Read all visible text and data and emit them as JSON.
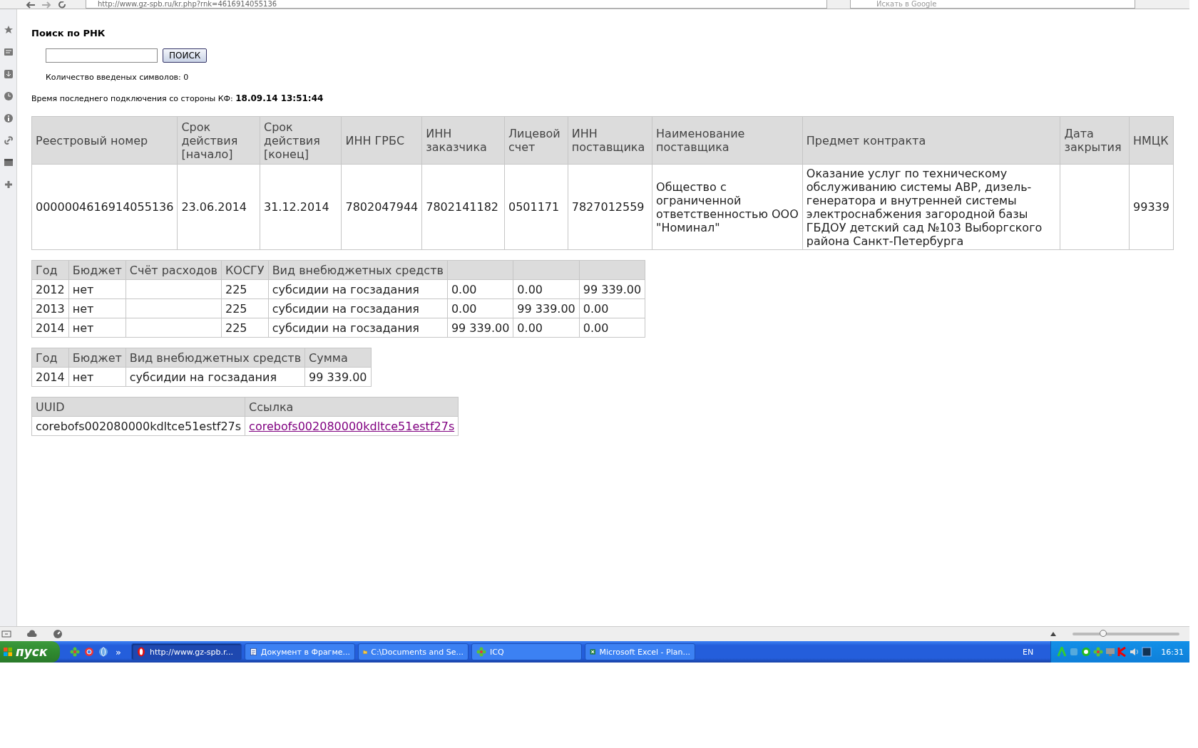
{
  "browser": {
    "url": "http://www.gz-spb.ru/kr.php?rnk=4616914055136",
    "search_placeholder": "Искать в Google"
  },
  "page": {
    "title": "Поиск по РНК",
    "search_button": "ПОИСК",
    "char_count": "Количество введеных символов: 0",
    "last_connection_label": "Время последнего подключения со стороны КФ:",
    "last_connection_value": "18.09.14 13:51:44"
  },
  "contract_table": {
    "columns": [
      "Реестровый номер",
      "Срок действия [начало]",
      "Срок действия [конец]",
      "ИНН ГРБС",
      "ИНН заказчика",
      "Лицевой счет",
      "ИНН поставщика",
      "Наименование поставщика",
      "Предмет контракта",
      "Дата закрытия",
      "НМЦК"
    ],
    "rows": [
      [
        "0000004616914055136",
        "23.06.2014",
        "31.12.2014",
        "7802047944",
        "7802141182",
        "0501171",
        "7827012559",
        "Общество с ограниченной ответственностью ООО \"Номинал\"",
        "Оказание услуг по техническому обслуживанию системы АВР, дизель-генератора и внутренней системы электроснабжения загородной базы ГБДОУ детский сад №103 Выборгского района Санкт-Петербурга",
        "",
        "99339"
      ]
    ]
  },
  "finance_table": {
    "columns": [
      "Год",
      "Бюджет",
      "Счёт расходов",
      "КОСГУ",
      "Вид внебюджетных средств"
    ],
    "rows": [
      [
        "2012",
        "нет",
        "",
        "225",
        "субсидии на госзадания",
        "0.00",
        "0.00",
        "99 339.00"
      ],
      [
        "2013",
        "нет",
        "",
        "225",
        "субсидии на госзадания",
        "0.00",
        "99 339.00",
        "0.00"
      ],
      [
        "2014",
        "нет",
        "",
        "225",
        "субсидии на госзадания",
        "99 339.00",
        "0.00",
        "0.00"
      ]
    ]
  },
  "sum_table": {
    "columns": [
      "Год",
      "Бюджет",
      "Вид внебюджетных средств",
      "Сумма"
    ],
    "rows": [
      [
        "2014",
        "нет",
        "субсидии на госзадания",
        "99 339.00"
      ]
    ]
  },
  "uuid_table": {
    "columns": [
      "UUID",
      "Ссылка"
    ],
    "rows": [
      {
        "uuid": "corebofs002080000kdltce51estf27s",
        "link": "corebofs002080000kdltce51estf27s"
      }
    ]
  },
  "zoom": {
    "level": 0.27
  },
  "taskbar": {
    "start": "пуск",
    "more": "»",
    "tasks": [
      {
        "label": "http://www.gz-spb.r...",
        "kind": "opera",
        "selected": true
      },
      {
        "label": "Документ в Фрагме...",
        "kind": "doc",
        "selected": false
      },
      {
        "label": "C:\\Documents and Se...",
        "kind": "folder",
        "selected": false
      },
      {
        "label": "ICQ",
        "kind": "flower",
        "selected": false
      },
      {
        "label": "Microsoft Excel - Plan...",
        "kind": "excel",
        "selected": false
      }
    ],
    "language": "EN",
    "clock": "16:31"
  }
}
